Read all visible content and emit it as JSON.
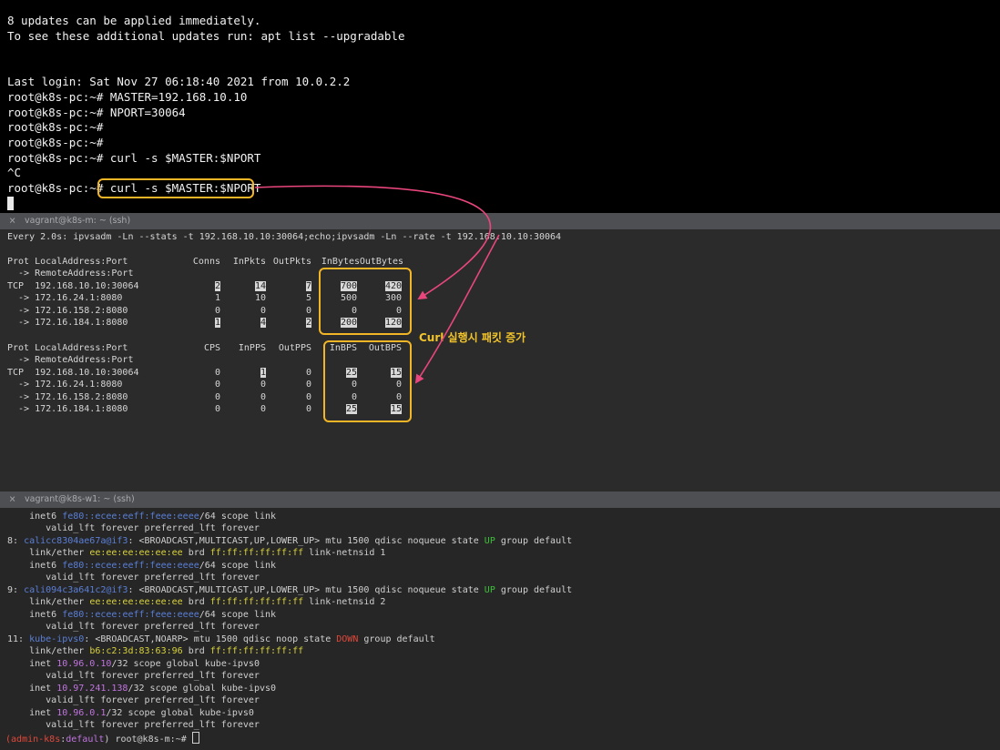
{
  "pane1": {
    "lines": [
      "8 updates can be applied immediately.",
      "To see these additional updates run: apt list --upgradable",
      "",
      "",
      "Last login: Sat Nov 27 06:18:40 2021 from 10.0.2.2",
      "root@k8s-pc:~# MASTER=192.168.10.10",
      "root@k8s-pc:~# NPORT=30064",
      "root@k8s-pc:~#",
      "root@k8s-pc:~#",
      "root@k8s-pc:~# curl -s $MASTER:$NPORT",
      "^C",
      "root@k8s-pc:~# curl -s $MASTER:$NPORT"
    ]
  },
  "tab2": {
    "close": "×",
    "title": "vagrant@k8s-m: ~ (ssh)"
  },
  "pane2": {
    "watch_header": "Every 2.0s: ipvsadm -Ln --stats -t 192.168.10.10:30064;echo;ipvsadm -Ln --rate -t 192.168.10.10:30064",
    "stats": {
      "headers": [
        "Prot LocalAddress:Port",
        "Conns",
        "InPkts",
        "OutPkts",
        "InBytes",
        "OutBytes"
      ],
      "subheader": "  -> RemoteAddress:Port",
      "rows": [
        [
          "TCP  192.168.10.10:30064",
          "2",
          "14",
          "7",
          "700",
          "420"
        ],
        [
          "  -> 172.16.24.1:8080",
          "1",
          "10",
          "5",
          "500",
          "300"
        ],
        [
          "  -> 172.16.158.2:8080",
          "0",
          "0",
          "0",
          "0",
          "0"
        ],
        [
          "  -> 172.16.184.1:8080",
          "1",
          "4",
          "2",
          "200",
          "120"
        ]
      ]
    },
    "rate": {
      "headers": [
        "Prot LocalAddress:Port",
        "CPS",
        "InPPS",
        "OutPPS",
        "InBPS",
        "OutBPS"
      ],
      "subheader": "  -> RemoteAddress:Port",
      "rows": [
        [
          "TCP  192.168.10.10:30064",
          "0",
          "1",
          "0",
          "25",
          "15"
        ],
        [
          "  -> 172.16.24.1:8080",
          "0",
          "0",
          "0",
          "0",
          "0"
        ],
        [
          "  -> 172.16.158.2:8080",
          "0",
          "0",
          "0",
          "0",
          "0"
        ],
        [
          "  -> 172.16.184.1:8080",
          "0",
          "0",
          "0",
          "25",
          "15"
        ]
      ]
    }
  },
  "annotation": {
    "text": "Curl 실행시 패킷 증가",
    "color": "#f2b526",
    "arrow_color": "#e8467c"
  },
  "tab3": {
    "close": "×",
    "title": "vagrant@k8s-w1: ~ (ssh)"
  },
  "pane3": {
    "l01": {
      "a": "    inet6 ",
      "addr": "fe80::ecee:eeff:feee:eeee",
      "b": "/64 scope link"
    },
    "l02": "       valid_lft forever preferred_lft forever",
    "l03": {
      "idx": "8: ",
      "name": "calicc8304ae67a@if3",
      "a": ": <BROADCAST,MULTICAST,UP,LOWER_UP> mtu 1500 qdisc noqueue state ",
      "state": "UP",
      "b": " group default"
    },
    "l04": {
      "a": "    link/ether ",
      "mac": "ee:ee:ee:ee:ee:ee",
      "b": " brd ",
      "brd": "ff:ff:ff:ff:ff:ff",
      "c": " link-netnsid 1"
    },
    "l05": {
      "a": "    inet6 ",
      "addr": "fe80::ecee:eeff:feee:eeee",
      "b": "/64 scope link"
    },
    "l06": "       valid_lft forever preferred_lft forever",
    "l07": {
      "idx": "9: ",
      "name": "cali094c3a641c2@if3",
      "a": ": <BROADCAST,MULTICAST,UP,LOWER_UP> mtu 1500 qdisc noqueue state ",
      "state": "UP",
      "b": " group default"
    },
    "l08": {
      "a": "    link/ether ",
      "mac": "ee:ee:ee:ee:ee:ee",
      "b": " brd ",
      "brd": "ff:ff:ff:ff:ff:ff",
      "c": " link-netnsid 2"
    },
    "l09": {
      "a": "    inet6 ",
      "addr": "fe80::ecee:eeff:feee:eeee",
      "b": "/64 scope link"
    },
    "l10": "       valid_lft forever preferred_lft forever",
    "l11": {
      "idx": "11: ",
      "name": "kube-ipvs0",
      "a": ": <BROADCAST,NOARP> mtu 1500 qdisc noop state ",
      "state": "DOWN",
      "b": " group default"
    },
    "l12": {
      "a": "    link/ether ",
      "mac": "b6:c2:3d:83:63:96",
      "b": " brd ",
      "brd": "ff:ff:ff:ff:ff:ff"
    },
    "l13": {
      "a": "    inet ",
      "addr": "10.96.0.10",
      "b": "/32 scope global kube-ipvs0"
    },
    "l14": "       valid_lft forever preferred_lft forever",
    "l15": {
      "a": "    inet ",
      "addr": "10.97.241.138",
      "b": "/32 scope global kube-ipvs0"
    },
    "l16": "       valid_lft forever preferred_lft forever",
    "l17": {
      "a": "    inet ",
      "addr": "10.96.0.1",
      "b": "/32 scope global kube-ipvs0"
    },
    "l18": "       valid_lft forever preferred_lft forever",
    "prompt": {
      "open": "(",
      "ctx": "admin-k8s",
      "sep": ":",
      "ns": "default",
      "close": ") root@k8s-m:~# "
    }
  }
}
